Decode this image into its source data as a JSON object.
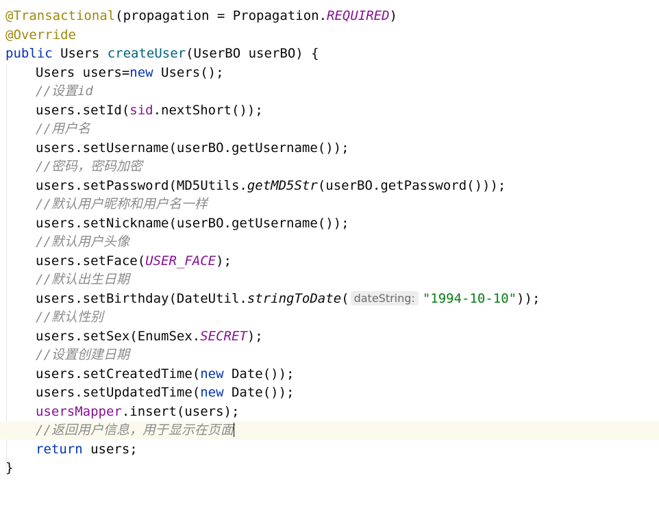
{
  "code": {
    "l1": {
      "ann": "@Transactional",
      "p1": "(propagation = Propagation.",
      "const": "REQUIRED",
      "p2": ")"
    },
    "l2": {
      "ann": "@Override"
    },
    "l3": {
      "kw": "public",
      "p1": " Users ",
      "fn": "createUser",
      "p2": "(UserBO userBO) {"
    },
    "l4": {
      "p1": "Users users=",
      "kw": "new",
      "p2": " Users();"
    },
    "l5": {
      "cmt": "//设置id"
    },
    "l6": {
      "p1": "users.setId(",
      "field": "sid",
      "p2": ".nextShort());"
    },
    "l7": {
      "cmt": "//用户名"
    },
    "l8": {
      "p1": "users.setUsername(userBO.getUsername());"
    },
    "l9": {
      "cmt": "//密码，密码加密"
    },
    "l10": {
      "p1": "users.setPassword(MD5Utils.",
      "static": "getMD5Str",
      "p2": "(userBO.getPassword()));"
    },
    "l11": {
      "cmt": "//默认用户昵称和用户名一样"
    },
    "l12": {
      "p1": "users.setNickname(userBO.getUsername());"
    },
    "l13": {
      "cmt": "//默认用户头像"
    },
    "l14": {
      "p1": "users.setFace(",
      "const": "USER_FACE",
      "p2": ");"
    },
    "l15": {
      "cmt": "//默认出生日期"
    },
    "l16": {
      "p1": "users.setBirthday(DateUtil.",
      "static": "stringToDate",
      "p2": "(",
      "hint": "dateString:",
      "str": "\"1994-10-10\"",
      "p3": "));"
    },
    "l17": {
      "cmt": "//默认性别"
    },
    "l18": {
      "p1": "users.setSex(EnumSex.",
      "const": "SECRET",
      "p2": ");"
    },
    "l19": {
      "cmt": "//设置创建日期"
    },
    "l20": {
      "p1": "users.setCreatedTime(",
      "kw": "new",
      "p2": " Date());"
    },
    "l21": {
      "p1": "users.setUpdatedTime(",
      "kw": "new",
      "p2": " Date());"
    },
    "l22": {
      "field": "usersMapper",
      "p1": ".insert(users);"
    },
    "l23": {
      "cmt": "//返回用户信息，用于显示在页面"
    },
    "l24": {
      "kw": "return",
      "p1": " users;"
    },
    "l25": {
      "p1": "}"
    }
  },
  "colors": {
    "annotation": "#9e880d",
    "keyword": "#0033b3",
    "method_declaration": "#00627a",
    "field_constant": "#871094",
    "comment": "#8c8c8c",
    "string": "#067d17",
    "current_line": "#fcfaed"
  }
}
